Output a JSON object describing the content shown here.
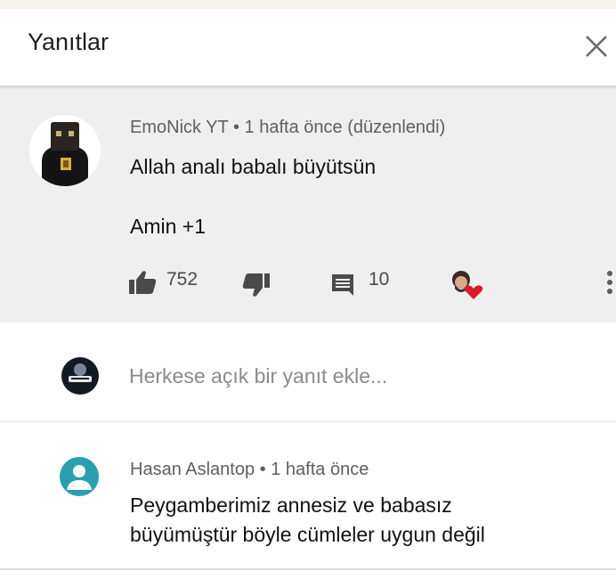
{
  "header": {
    "title": "Yanıtlar",
    "close_icon": "close-icon"
  },
  "main_comment": {
    "author": "EmoNick YT",
    "separator": "•",
    "time": "1 hafta önce (düzenlendi)",
    "line1": "Allah analı babalı büyütsün",
    "line2": "Amin +1",
    "likes": "752",
    "replies": "10",
    "icons": [
      "thumb-up-icon",
      "thumb-down-icon",
      "reply-comment-icon",
      "creator-heart-icon",
      "more-vert-icon"
    ]
  },
  "reply_input": {
    "placeholder": "Herkese açık bir yanıt ekle..."
  },
  "reply": {
    "author": "Hasan Aslantop",
    "separator": "•",
    "time": "1 hafta önce",
    "line1": "Peygamberimiz annesiz ve babasız",
    "line2": "büyümüştür böyle cümleler uygun değil"
  },
  "colors": {
    "accent_teal": "#2a9fb0",
    "heart_red": "#d81b24",
    "highlight_bg": "#efefef"
  }
}
